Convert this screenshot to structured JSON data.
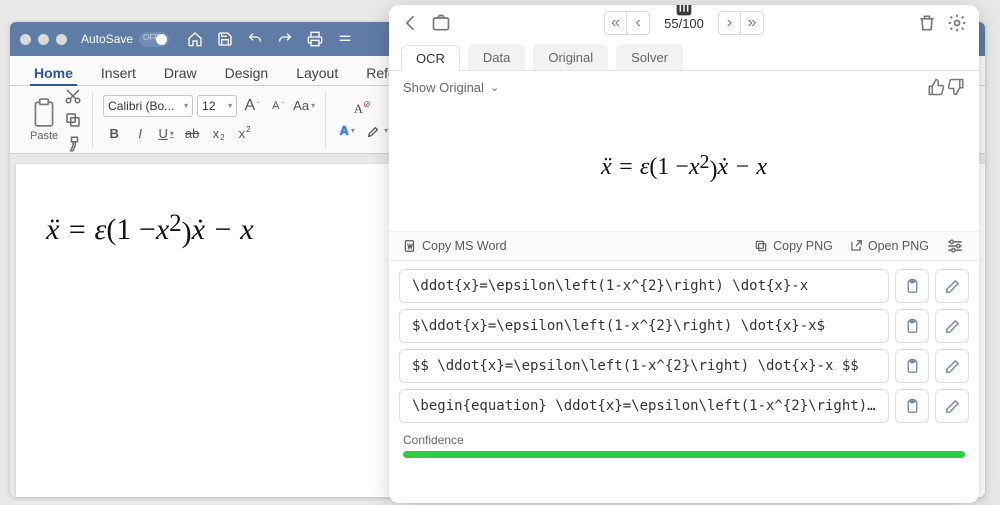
{
  "titlebar": {
    "autosave_label": "AutoSave",
    "autosave_state": "OFF"
  },
  "ribbon_tabs": [
    "Home",
    "Insert",
    "Draw",
    "Design",
    "Layout",
    "Referen"
  ],
  "active_ribbon_tab": 0,
  "ribbon": {
    "paste_label": "Paste",
    "font_name": "Calibri (Bo...",
    "font_size": "12",
    "aa_label": "Aa"
  },
  "equation_html": "<span>ẍ = &epsilon;</span><span class='up'>(1 &minus; </span><span>x</span><span class='up'><sup>2</sup>)</span><span>ẋ &minus; x</span>",
  "panel": {
    "counter": "55/100",
    "tabs": [
      "OCR",
      "Data",
      "Original",
      "Solver"
    ],
    "active_tab": 0,
    "show_original": "Show Original",
    "copybar": {
      "ms_word": "Copy MS Word",
      "copy_png": "Copy PNG",
      "open_png": "Open PNG"
    },
    "latex_rows": [
      "\\ddot{x}=\\epsilon\\left(1-x^{2}\\right) \\dot{x}-x",
      "$\\ddot{x}=\\epsilon\\left(1-x^{2}\\right) \\dot{x}-x$",
      "$$ \\ddot{x}=\\epsilon\\left(1-x^{2}\\right) \\dot{x}-x $$",
      "\\begin{equation} \\ddot{x}=\\epsilon\\left(1-x^{2}\\right)…"
    ],
    "confidence_label": "Confidence"
  }
}
